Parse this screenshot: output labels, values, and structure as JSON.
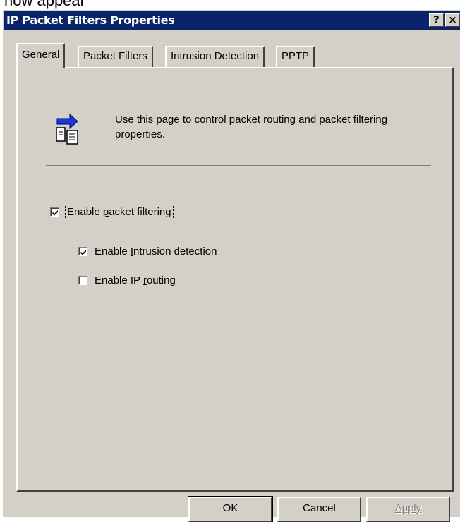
{
  "document": {
    "heading_fragment": "now appear"
  },
  "window": {
    "title": "IP Packet Filters Properties",
    "help_button": "?",
    "close_button": "×"
  },
  "tabs": [
    {
      "label": "General",
      "active": true
    },
    {
      "label": "Packet Filters",
      "active": false
    },
    {
      "label": "Intrusion Detection",
      "active": false
    },
    {
      "label": "PPTP",
      "active": false
    }
  ],
  "general": {
    "description": "Use this page to control packet routing and packet filtering properties.",
    "icon": "packet-routing-icon",
    "enable_packet_filtering": {
      "label_pre": "Enable ",
      "label_ul": "p",
      "label_post": "acket filtering",
      "checked": true
    },
    "enable_intrusion_detection": {
      "label_pre": "Enable ",
      "label_ul": "I",
      "label_post": "ntrusion detection",
      "checked": true
    },
    "enable_ip_routing": {
      "label_pre": "Enable IP ",
      "label_ul": "r",
      "label_post": "outing",
      "checked": false
    }
  },
  "buttons": {
    "ok": "OK",
    "cancel": "Cancel",
    "apply": "Apply"
  },
  "colors": {
    "titlebar": "#0a246a",
    "face": "#d4d0c8"
  }
}
